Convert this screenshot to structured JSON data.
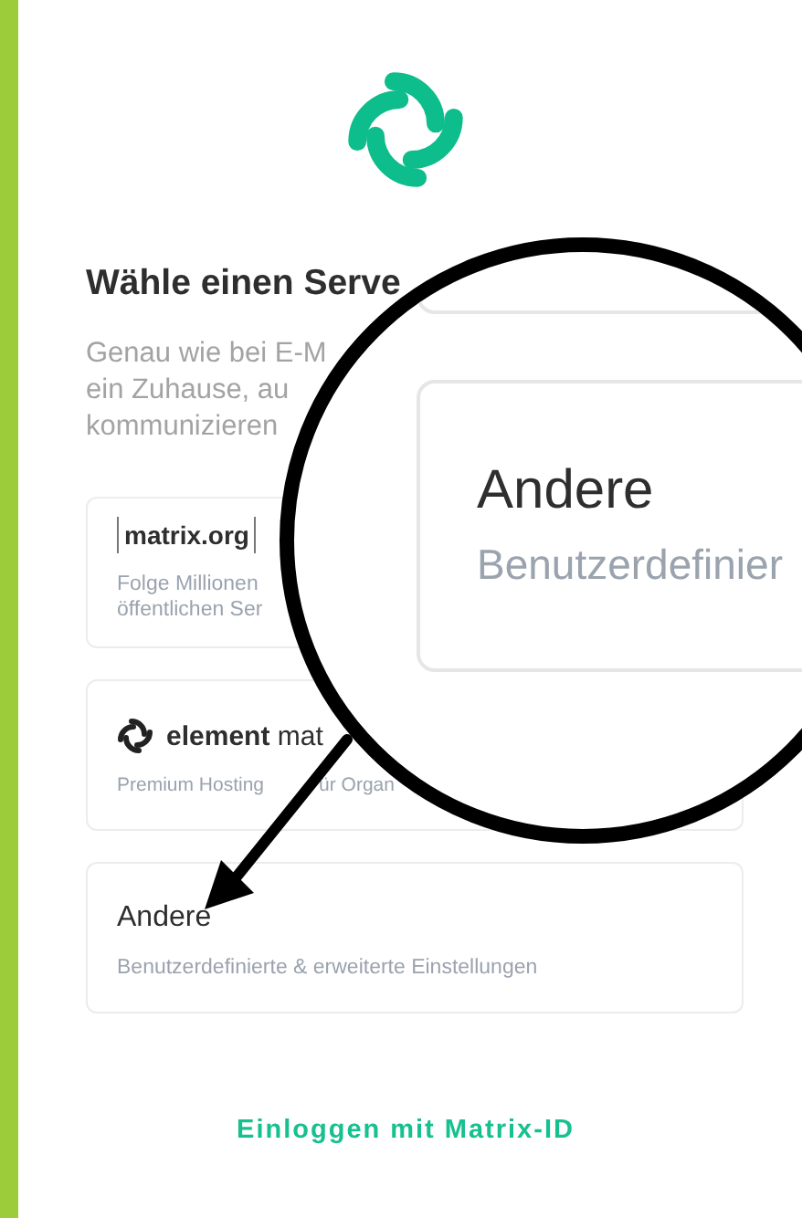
{
  "heading": "Wähle einen Serve",
  "description": [
    "Genau wie bei E-M",
    "ein Zuhause, au",
    "kommunizieren"
  ],
  "servers": [
    {
      "kind": "matrix",
      "logo_text": "matrix.org",
      "subtitle": [
        "Folge Millionen",
        "öffentlichen Ser"
      ]
    },
    {
      "kind": "element",
      "logo_text": "**element** mat",
      "subtitle": [
        "Premium Hosting"
      ],
      "subtitle_after_arrow": "ür Organ"
    },
    {
      "kind": "other",
      "title": "Andere",
      "subtitle": [
        "Benutzerdefinierte & erweiterte Einstellungen"
      ]
    }
  ],
  "magnifier": {
    "title": "Andere",
    "subtitle": "Benutzerdefinier"
  },
  "login_link": "Einloggen mit Matrix-ID"
}
